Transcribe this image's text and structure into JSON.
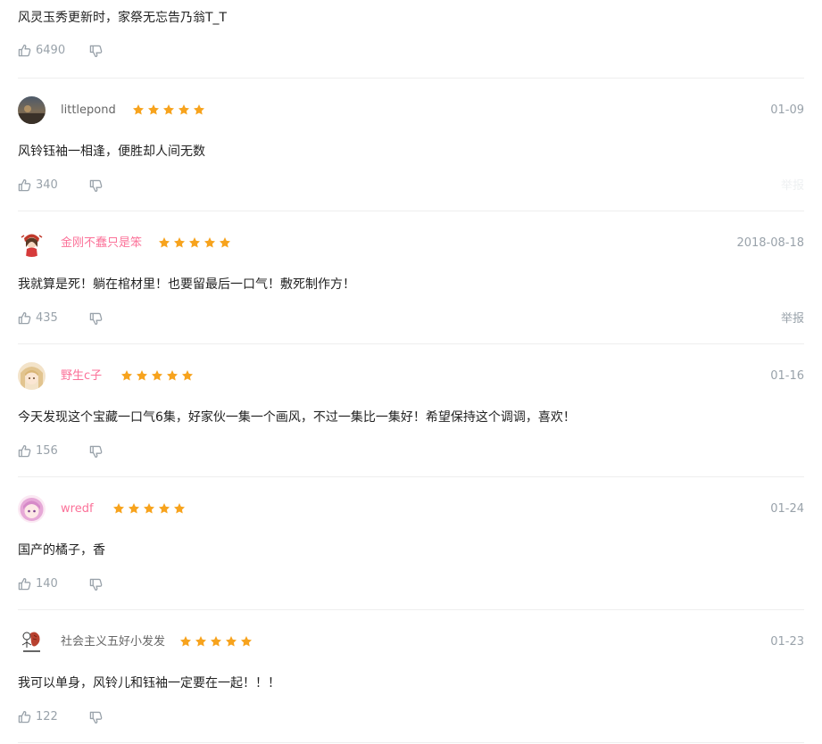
{
  "colors": {
    "accent_pink": "#fb7299",
    "star_orange": "#f7a31d",
    "muted_text": "#99a2aa",
    "divider": "#eeeeee"
  },
  "icons": {
    "like": "thumb-up-icon",
    "dislike": "thumb-down-icon",
    "star": "star-icon"
  },
  "first_review": {
    "content": "风灵玉秀更新时，家祭无忘告乃翁T_T",
    "likes": "6490"
  },
  "reviews": [
    {
      "username": "littlepond",
      "rating": 5,
      "date": "01-09",
      "content": "风铃钰袖一相逢，便胜却人间无数",
      "likes": "340",
      "report": "举报"
    },
    {
      "username": "金刚不蠢只是笨",
      "rating": 5,
      "date": "2018-08-18",
      "content": "我就算是死！躺在棺材里！也要留最后一口气！敷死制作方！",
      "likes": "435",
      "report": "举报"
    },
    {
      "username": "野生c子",
      "rating": 5,
      "date": "01-16",
      "content": "今天发现这个宝藏一口气6集，好家伙一集一个画风，不过一集比一集好！希望保持这个调调，喜欢！",
      "likes": "156"
    },
    {
      "username": "wredf",
      "rating": 5,
      "date": "01-24",
      "content": "国产的橘子，香",
      "likes": "140"
    },
    {
      "username": "社会主义五好小发发",
      "rating": 5,
      "date": "01-23",
      "content": "我可以单身，风铃儿和钰袖一定要在一起！！！",
      "likes": "122"
    }
  ]
}
